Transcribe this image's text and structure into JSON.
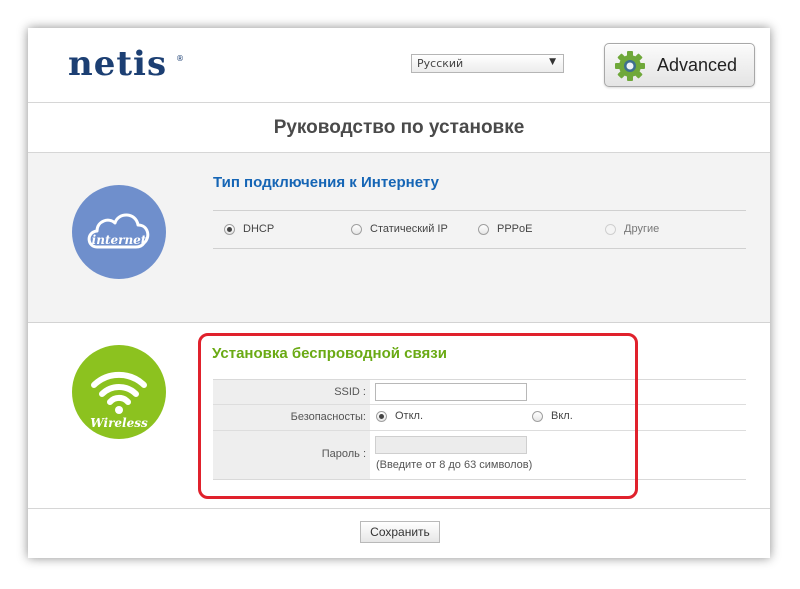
{
  "header": {
    "logo": "netis",
    "logo_mark": "®",
    "language": "Русский",
    "advanced_label": "Advanced"
  },
  "title": "Руководство по установке",
  "internet": {
    "icon_text": "internet",
    "heading": "Тип подключения к Интернету",
    "options": [
      {
        "label": "DHCP",
        "selected": true
      },
      {
        "label": "Статический IP",
        "selected": false
      },
      {
        "label": "PPPoE",
        "selected": false
      },
      {
        "label": "Другие",
        "selected": false
      }
    ]
  },
  "wireless": {
    "icon_text": "Wireless",
    "heading": "Установка беспроводной связи",
    "ssid_label": "SSID :",
    "ssid_value": "",
    "security_label": "Безопасносты:",
    "security_off": "Откл.",
    "security_on": "Вкл.",
    "security_selected": "off",
    "password_label": "Пароль :",
    "password_value": "",
    "password_hint": "(Введите от 8 до 63 символов)"
  },
  "footer": {
    "save_label": "Сохранить"
  },
  "colors": {
    "internet_circle": "#6f8fcc",
    "wireless_circle": "#8cc21f",
    "heading_blue": "#1565b5",
    "heading_green": "#6aaa14",
    "highlight_red": "#e0212c",
    "logo_navy": "#1c3f73"
  },
  "icons": [
    "gear-icon",
    "cloud-icon",
    "wifi-icon",
    "chevron-down-icon"
  ]
}
